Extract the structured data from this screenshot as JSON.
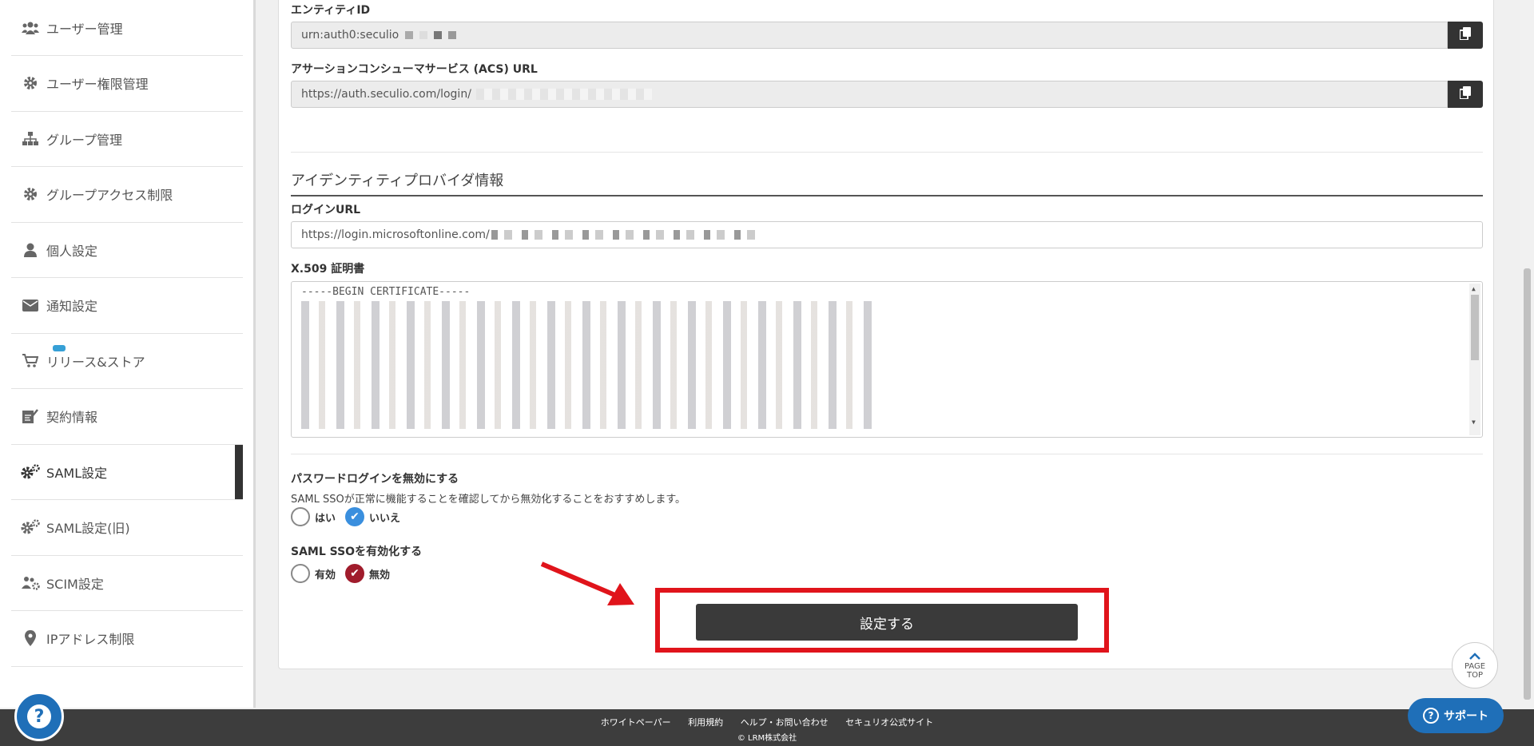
{
  "sidebar": {
    "items": [
      {
        "label": "ユーザー管理",
        "icon": "users-icon"
      },
      {
        "label": "ユーザー権限管理",
        "icon": "gear-icon"
      },
      {
        "label": "グループ管理",
        "icon": "sitemap-icon"
      },
      {
        "label": "グループアクセス制限",
        "icon": "gear-icon"
      },
      {
        "label": "個人設定",
        "icon": "user-icon"
      },
      {
        "label": "通知設定",
        "icon": "envelope-icon"
      },
      {
        "label": "リリース&ストア",
        "icon": "cart-icon"
      },
      {
        "label": "契約情報",
        "icon": "contract-icon"
      },
      {
        "label": "SAML設定",
        "icon": "gears-icon",
        "active": true
      },
      {
        "label": "SAML設定(旧)",
        "icon": "gears-icon"
      },
      {
        "label": "SCIM設定",
        "icon": "users-gear-icon"
      },
      {
        "label": "IPアドレス制限",
        "icon": "map-marker-icon"
      }
    ]
  },
  "sp_info": {
    "entity_id_label": "エンティティID",
    "entity_id_value": "urn:auth0:seculio",
    "acs_url_label": "アサーションコンシューマサービス (ACS) URL",
    "acs_url_value": "https://auth.seculio.com/login/"
  },
  "idp_info": {
    "section_title": "アイデンティティプロバイダ情報",
    "login_url_label": "ログインURL",
    "login_url_value": "https://login.microsoftonline.com/",
    "cert_label": "X.509 証明書",
    "cert_value": "-----BEGIN CERTIFICATE-----"
  },
  "password_login": {
    "label": "パスワードログインを無効にする",
    "note": "SAML SSOが正常に機能することを確認してから無効化することをおすすめします。",
    "options": [
      "はい",
      "いいえ"
    ],
    "selected": "いいえ"
  },
  "saml_sso": {
    "label": "SAML SSOを有効化する",
    "options": [
      "有効",
      "無効"
    ],
    "selected": "無効"
  },
  "submit_label": "設定する",
  "page_top": {
    "line1": "PAGE",
    "line2": "TOP"
  },
  "footer": {
    "links": [
      "ホワイトペーパー",
      "利用規約",
      "ヘルプ・お問い合わせ",
      "セキュリオ公式サイト"
    ],
    "copyright": "© LRM株式会社"
  },
  "support_label": "サポート",
  "colors": {
    "accent_blue": "#1f6fb8",
    "highlight_red": "#e0141b",
    "button_dark": "#3a3a3a",
    "radio_blue": "#3a8fde",
    "radio_red": "#a01c2c"
  }
}
